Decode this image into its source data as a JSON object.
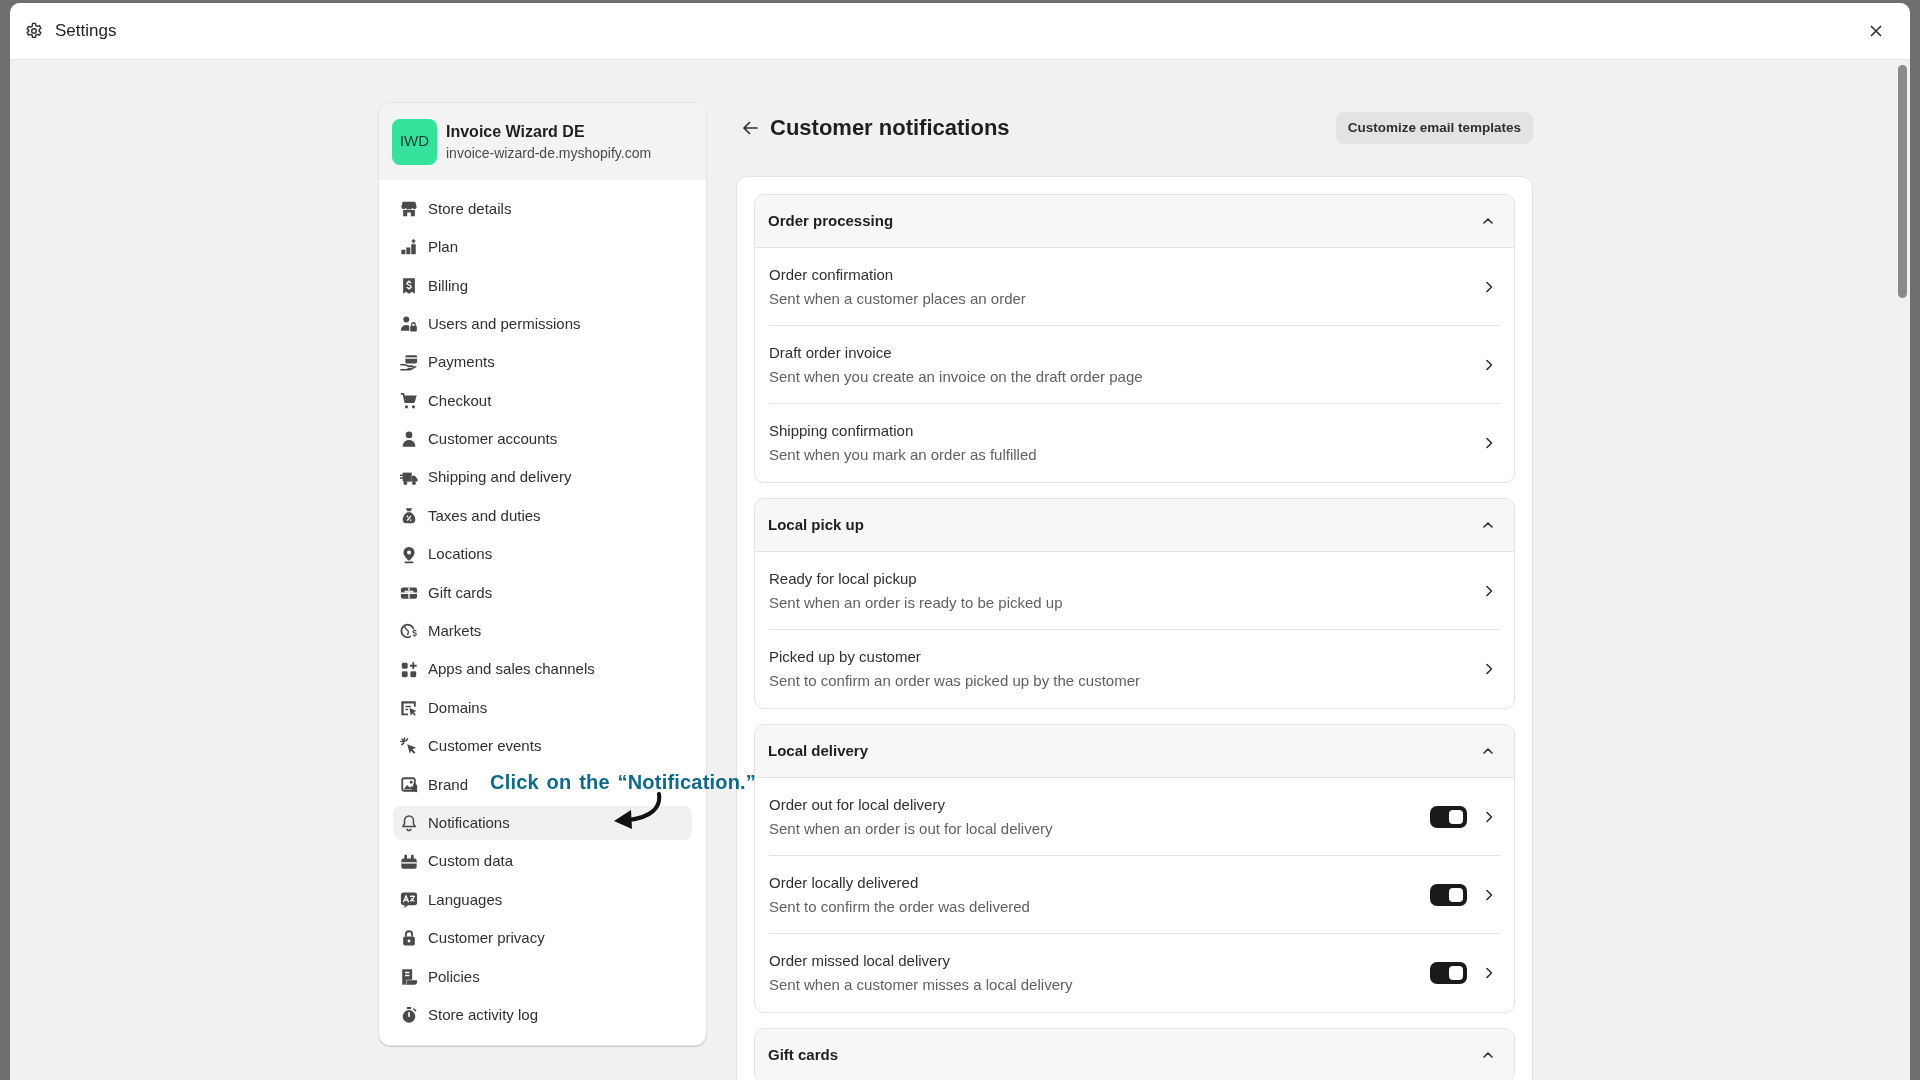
{
  "window": {
    "title": "Settings"
  },
  "store": {
    "initials": "IWD",
    "name": "Invoice Wizard DE",
    "domain": "invoice-wizard-de.myshopify.com"
  },
  "sidebar": {
    "items": [
      {
        "label": "Store details",
        "selected": false
      },
      {
        "label": "Plan",
        "selected": false
      },
      {
        "label": "Billing",
        "selected": false
      },
      {
        "label": "Users and permissions",
        "selected": false
      },
      {
        "label": "Payments",
        "selected": false
      },
      {
        "label": "Checkout",
        "selected": false
      },
      {
        "label": "Customer accounts",
        "selected": false
      },
      {
        "label": "Shipping and delivery",
        "selected": false
      },
      {
        "label": "Taxes and duties",
        "selected": false
      },
      {
        "label": "Locations",
        "selected": false
      },
      {
        "label": "Gift cards",
        "selected": false
      },
      {
        "label": "Markets",
        "selected": false
      },
      {
        "label": "Apps and sales channels",
        "selected": false
      },
      {
        "label": "Domains",
        "selected": false
      },
      {
        "label": "Customer events",
        "selected": false
      },
      {
        "label": "Brand",
        "selected": false
      },
      {
        "label": "Notifications",
        "selected": true
      },
      {
        "label": "Custom data",
        "selected": false
      },
      {
        "label": "Languages",
        "selected": false
      },
      {
        "label": "Customer privacy",
        "selected": false
      },
      {
        "label": "Policies",
        "selected": false
      },
      {
        "label": "Store activity log",
        "selected": false
      }
    ]
  },
  "page": {
    "title": "Customer notifications",
    "action": "Customize email templates"
  },
  "sections": [
    {
      "title": "Order processing",
      "expanded": true,
      "rows": [
        {
          "kind": "link",
          "title": "Order confirmation",
          "description": "Sent when a customer places an order"
        },
        {
          "kind": "link",
          "title": "Draft order invoice",
          "description": "Sent when you create an invoice on the draft order page"
        },
        {
          "kind": "link",
          "title": "Shipping confirmation",
          "description": "Sent when you mark an order as fulfilled"
        }
      ]
    },
    {
      "title": "Local pick up",
      "expanded": true,
      "rows": [
        {
          "kind": "link",
          "title": "Ready for local pickup",
          "description": "Sent when an order is ready to be picked up"
        },
        {
          "kind": "link",
          "title": "Picked up by customer",
          "description": "Sent to confirm an order was picked up by the customer"
        }
      ]
    },
    {
      "title": "Local delivery",
      "expanded": true,
      "rows": [
        {
          "kind": "toggle",
          "on": true,
          "title": "Order out for local delivery",
          "description": "Sent when an order is out for local delivery"
        },
        {
          "kind": "toggle",
          "on": true,
          "title": "Order locally delivered",
          "description": "Sent to confirm the order was delivered"
        },
        {
          "kind": "toggle",
          "on": true,
          "title": "Order missed local delivery",
          "description": "Sent when a customer misses a local delivery"
        }
      ]
    },
    {
      "title": "Gift cards",
      "expanded": true
    }
  ],
  "annotation": {
    "text": "Click on the “Notification.”"
  }
}
